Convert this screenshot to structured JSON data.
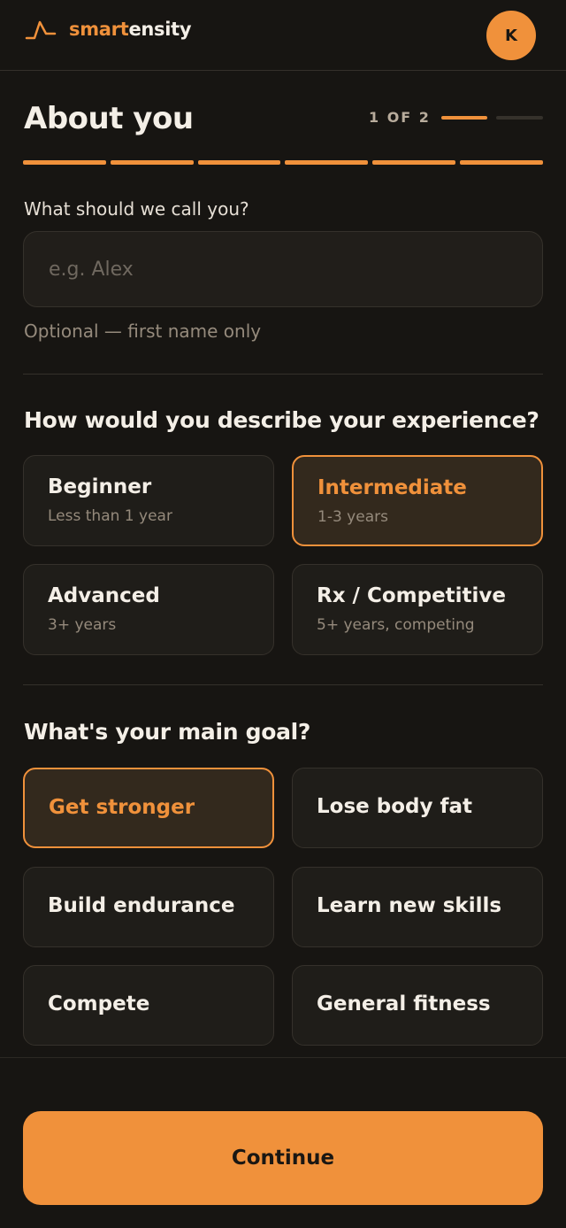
{
  "header": {
    "brand_accent": "smart",
    "brand_rest": "ensity",
    "avatar_initial": "K"
  },
  "page": {
    "title": "About you",
    "step_text": "1 OF 2",
    "current_step": 1,
    "total_steps": 2
  },
  "name": {
    "label": "What should we call you?",
    "placeholder": "e.g. Alex",
    "value": "",
    "hint": "Optional — first name only"
  },
  "experience": {
    "question": "How would you describe your experience?",
    "options": [
      {
        "title": "Beginner",
        "subtitle": "Less than 1 year",
        "selected": false
      },
      {
        "title": "Intermediate",
        "subtitle": "1-3 years",
        "selected": true
      },
      {
        "title": "Advanced",
        "subtitle": "3+ years",
        "selected": false
      },
      {
        "title": "Rx / Competitive",
        "subtitle": "5+ years, competing",
        "selected": false
      }
    ]
  },
  "goal": {
    "question": "What's your main goal?",
    "options": [
      {
        "title": "Get stronger",
        "selected": true
      },
      {
        "title": "Lose body fat",
        "selected": false
      },
      {
        "title": "Build endurance",
        "selected": false
      },
      {
        "title": "Learn new skills",
        "selected": false
      },
      {
        "title": "Compete",
        "selected": false
      },
      {
        "title": "General fitness",
        "selected": false
      }
    ]
  },
  "actions": {
    "continue_label": "Continue"
  },
  "colors": {
    "background": "#171512",
    "accent": "#f0913b",
    "card": "#1f1d19",
    "selected_card": "#33291d",
    "muted_text": "#958a7c"
  },
  "icons": {
    "logo": "graph-line-logo-icon"
  }
}
